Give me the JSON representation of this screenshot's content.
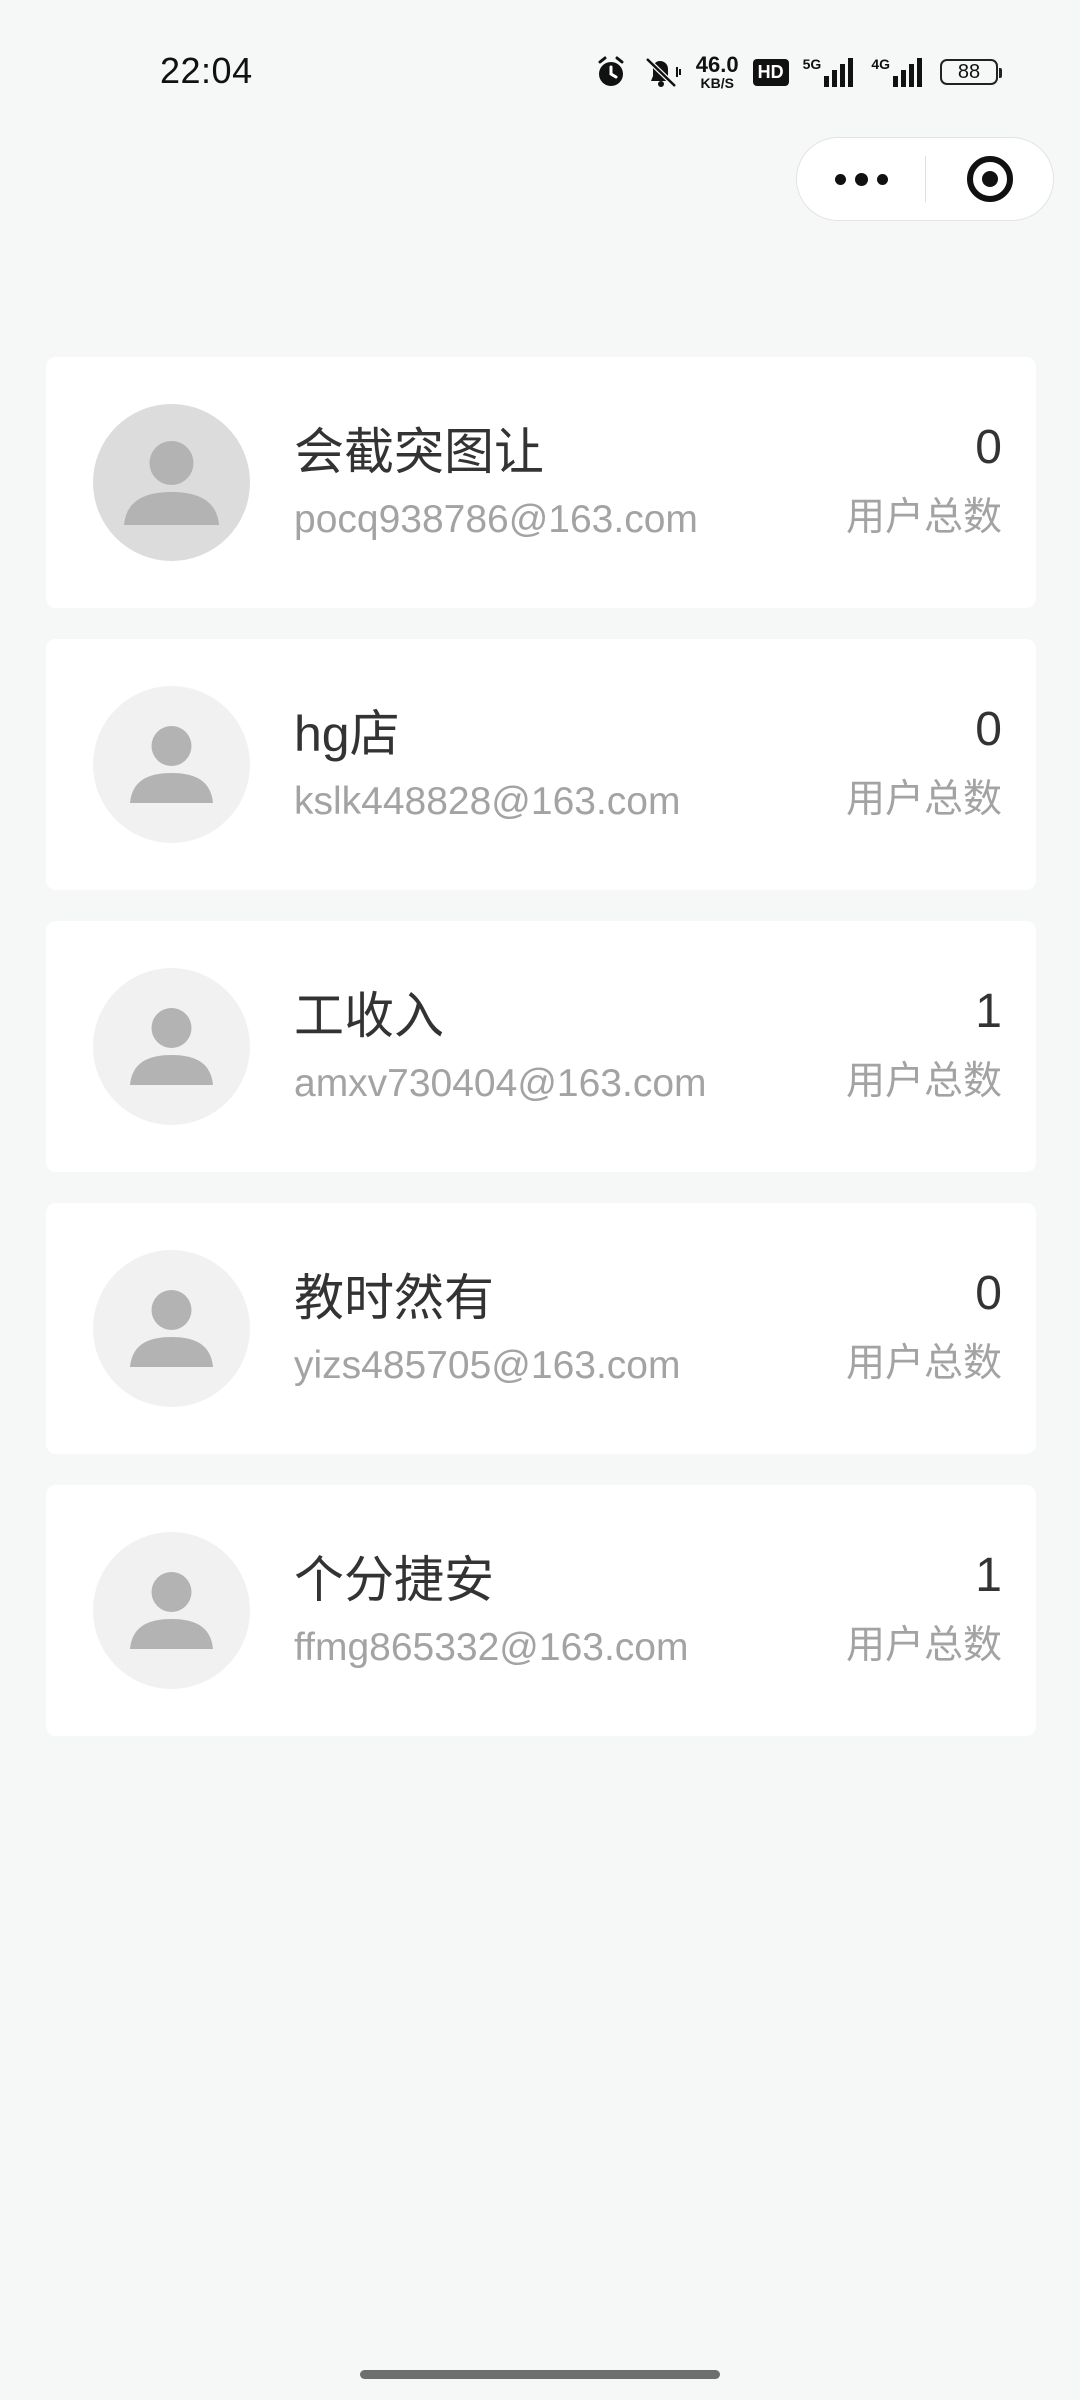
{
  "status_bar": {
    "time": "22:04",
    "net_speed_value": "46.0",
    "net_speed_unit": "KB/S",
    "hd_label": "HD",
    "net_5g": "5G",
    "net_4g": "4G",
    "battery": "88",
    "icons": [
      "alarm-icon",
      "mute-icon",
      "hd-icon",
      "signal-5g-icon",
      "signal-4g-icon",
      "battery-icon"
    ]
  },
  "capsule": {
    "icons": [
      "more-dots-icon",
      "close-miniprogram-icon"
    ]
  },
  "shops": [
    {
      "name": "会截突图让",
      "email": "pocq938786@163.com",
      "count": "0",
      "count_label": "用户总数",
      "avatar_icon": "user-avatar-icon"
    },
    {
      "name": "hg店",
      "email": "kslk448828@163.com",
      "count": "0",
      "count_label": "用户总数",
      "avatar_icon": "user-avatar-icon"
    },
    {
      "name": "工收入",
      "email": "amxv730404@163.com",
      "count": "1",
      "count_label": "用户总数",
      "avatar_icon": "user-avatar-icon"
    },
    {
      "name": "教时然有",
      "email": "yizs485705@163.com",
      "count": "0",
      "count_label": "用户总数",
      "avatar_icon": "user-avatar-icon"
    },
    {
      "name": "个分捷安",
      "email": "ffmg865332@163.com",
      "count": "1",
      "count_label": "用户总数",
      "avatar_icon": "user-avatar-icon"
    }
  ],
  "colors": {
    "background": "#f6f7f7",
    "card": "#ffffff",
    "primary_text": "#333333",
    "secondary_text": "#a3a3a3",
    "avatar_bg": "#f1f1f2",
    "avatar_figure": "#b3b3b3"
  }
}
